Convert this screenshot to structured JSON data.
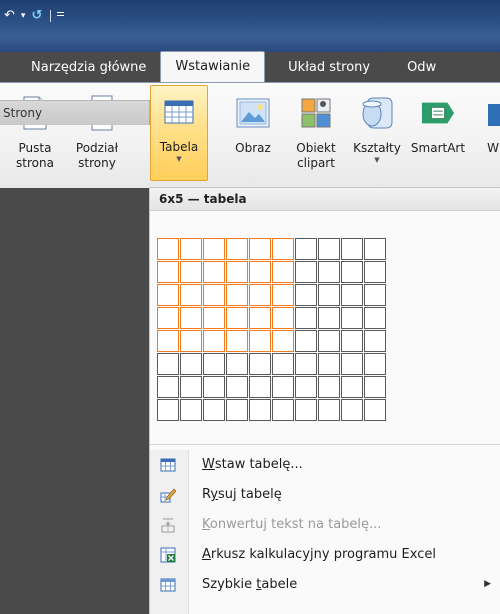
{
  "quick_access": {
    "undo_glyph": "↶",
    "dropdown_glyph": "▾",
    "redo_glyph": "↺"
  },
  "tabs": [
    {
      "label": "Narzędzia główne",
      "active": false
    },
    {
      "label": "Wstawianie",
      "active": true
    },
    {
      "label": "Układ strony",
      "active": false
    },
    {
      "label": "Odw",
      "active": false
    }
  ],
  "ribbon": {
    "buttons": {
      "pusta": "Pusta\nstrona",
      "podzial": "Podział\nstrony",
      "tabela": "Tabela",
      "tabela_arrow": "▼",
      "obraz": "Obraz",
      "clipart": "Obiekt\nclipart",
      "ksztalty": "Kształty",
      "ksztalty_arrow": "▼",
      "smartart": "SmartArt",
      "cut": "W"
    },
    "group_label": "Strony"
  },
  "table_picker": {
    "header": "6x5 — tabela",
    "columns": 10,
    "rows": 8,
    "selected_columns": 6,
    "selected_rows": 5
  },
  "menu": {
    "items": [
      {
        "id": "insert",
        "pre": "",
        "key": "W",
        "post": "staw tabelę...",
        "icon": "table-grid-icon",
        "disabled": false,
        "submenu": false
      },
      {
        "id": "draw",
        "pre": "R",
        "key": "y",
        "post": "suj tabelę",
        "icon": "pencil-icon",
        "disabled": false,
        "submenu": false
      },
      {
        "id": "convert",
        "pre": "",
        "key": "K",
        "post": "onwertuj tekst na tabelę...",
        "icon": "convert-text-icon",
        "disabled": true,
        "submenu": false
      },
      {
        "id": "excel",
        "pre": "",
        "key": "A",
        "post": "rkusz kalkulacyjny programu Excel",
        "icon": "excel-sheet-icon",
        "disabled": false,
        "submenu": false
      },
      {
        "id": "quick",
        "pre": "Szybkie ",
        "key": "t",
        "post": "abele",
        "icon": "quick-tables-icon",
        "disabled": false,
        "submenu": true,
        "submenu_glyph": "▶"
      }
    ]
  },
  "colors": {
    "selection_border": "#f37a1f",
    "highlight": "#ffe08a"
  }
}
